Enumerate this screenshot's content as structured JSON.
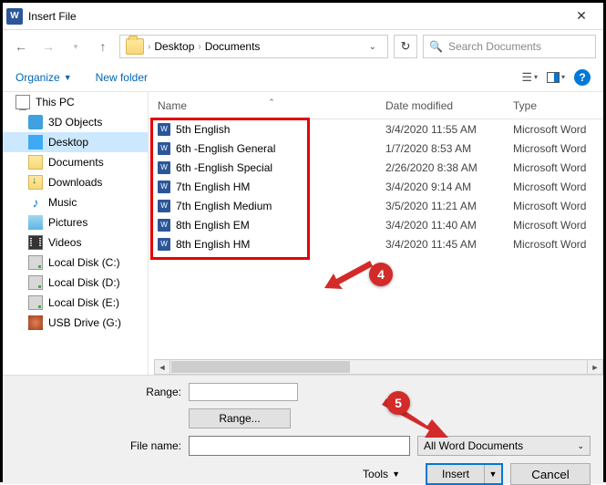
{
  "window": {
    "title": "Insert File"
  },
  "breadcrumb": {
    "seg1": "Desktop",
    "seg2": "Documents"
  },
  "search": {
    "placeholder": "Search Documents"
  },
  "cmdbar": {
    "organize": "Organize",
    "newfolder": "New folder"
  },
  "tree": {
    "thispc": "This PC",
    "objects3d": "3D Objects",
    "desktop": "Desktop",
    "documents": "Documents",
    "downloads": "Downloads",
    "music": "Music",
    "pictures": "Pictures",
    "videos": "Videos",
    "localc": "Local Disk (C:)",
    "locald": "Local Disk (D:)",
    "locale": "Local Disk (E:)",
    "usbg": "USB Drive (G:)"
  },
  "columns": {
    "name": "Name",
    "date": "Date modified",
    "type": "Type"
  },
  "files": [
    {
      "name": "5th English",
      "date": "3/4/2020 11:55 AM",
      "type": "Microsoft Word"
    },
    {
      "name": "6th -English General",
      "date": "1/7/2020 8:53 AM",
      "type": "Microsoft Word"
    },
    {
      "name": "6th -English Special",
      "date": "2/26/2020 8:38 AM",
      "type": "Microsoft Word"
    },
    {
      "name": "7th English HM",
      "date": "3/4/2020 9:14 AM",
      "type": "Microsoft Word"
    },
    {
      "name": "7th English Medium",
      "date": "3/5/2020 11:21 AM",
      "type": "Microsoft Word"
    },
    {
      "name": "8th English EM",
      "date": "3/4/2020 11:40 AM",
      "type": "Microsoft Word"
    },
    {
      "name": "8th English HM",
      "date": "3/4/2020 11:45 AM",
      "type": "Microsoft Word"
    }
  ],
  "bottom": {
    "range_label": "Range:",
    "range_button": "Range...",
    "filename_label": "File name:",
    "filter": "All Word Documents",
    "tools": "Tools",
    "insert": "Insert",
    "cancel": "Cancel"
  },
  "annotations": {
    "b4": "4",
    "b5": "5"
  }
}
